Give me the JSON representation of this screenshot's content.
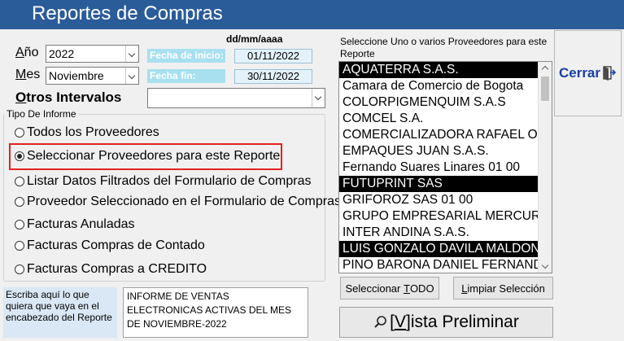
{
  "window": {
    "title": "Reportes de Compras"
  },
  "fields": {
    "anio_label": "Año",
    "anio_value": "2022",
    "mes_label": "Mes",
    "mes_value": "Noviembre",
    "otros_label": "Otros Intervalos",
    "otros_value": "",
    "date_format": "dd/mm/aaaa",
    "fecha_inicio_label": "Fecha de inicio:",
    "fecha_inicio_value": "01/11/2022",
    "fecha_fin_label": "Fecha fin:",
    "fecha_fin_value": "30/11/2022"
  },
  "tipo_informe": {
    "legend": "Tipo De Informe",
    "options": [
      {
        "label": "Todos los Proveedores",
        "checked": false
      },
      {
        "label": "Seleccionar Proveedores para este Reporte",
        "checked": true
      },
      {
        "label": "Listar Datos Filtrados del Formulario de Compras",
        "checked": false
      },
      {
        "label": "Proveedor Seleccionado en el Formulario de Compras",
        "checked": false
      },
      {
        "label": "Facturas Anuladas",
        "checked": false
      },
      {
        "label": "Facturas Compras de Contado",
        "checked": false
      },
      {
        "label": "Facturas Compras a CREDITO",
        "checked": false
      }
    ]
  },
  "encabezado": {
    "label": "Escriba aquí lo que quiera que vaya en el encabezado del Reporte",
    "text": "INFORME DE VENTAS ELECTRONICAS ACTIVAS DEL MES DE NOVIEMBRE-2022"
  },
  "proveedores": {
    "caption": "Seleccione Uno o varios Proveedores para este Reporte",
    "items": [
      {
        "name": "AQUATERRA S.A.S.",
        "selected": true
      },
      {
        "name": "Camara de Comercio de Bogota",
        "selected": false
      },
      {
        "name": "COLORPIGMENQUIM S.A.S",
        "selected": false
      },
      {
        "name": "COMCEL S.A.",
        "selected": false
      },
      {
        "name": "COMERCIALIZADORA RAFAEL OV",
        "selected": false
      },
      {
        "name": "EMPAQUES JUAN S.A.S.",
        "selected": false
      },
      {
        "name": "Fernando Suares Linares 01 00",
        "selected": false
      },
      {
        "name": "FUTUPRINT SAS",
        "selected": true
      },
      {
        "name": "GRIFOROZ SAS 01 00",
        "selected": false
      },
      {
        "name": "GRUPO EMPRESARIAL MERCURY",
        "selected": false
      },
      {
        "name": "INTER ANDINA S.A.S.",
        "selected": false
      },
      {
        "name": "LUIS GONZALO DAVILA MALDON",
        "selected": true
      },
      {
        "name": "PINO BARONA DANIEL FERNAND",
        "selected": false
      }
    ]
  },
  "buttons": {
    "cerrar": "Cerrar",
    "seleccionar_todo_pre": "Seleccionar ",
    "seleccionar_todo_ul": "T",
    "seleccionar_todo_post": "ODO",
    "limpiar_pre": "",
    "limpiar_ul": "L",
    "limpiar_post": "impiar Selección",
    "vista_pre": "[",
    "vista_ul": "V",
    "vista_post": "]ista Preliminar"
  },
  "colors": {
    "title_bar": "#2b5c9a",
    "highlight_border": "#e32222",
    "cerrar_text": "#1a3ea8"
  }
}
